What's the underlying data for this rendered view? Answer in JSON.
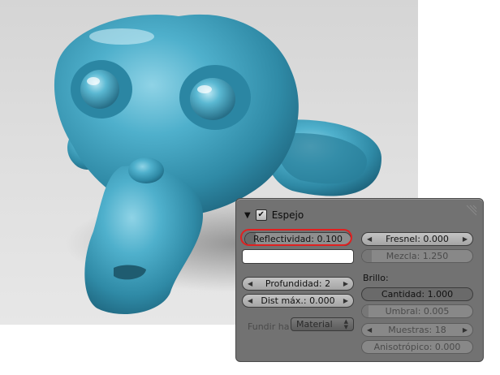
{
  "panel": {
    "title": "Espejo",
    "enabled": true,
    "reflectivity": {
      "label": "Reflectividad",
      "value": "0.100",
      "fill": 0.1
    },
    "color_hex": "#ffffff",
    "depth": {
      "label": "Profundidad",
      "value": "2"
    },
    "max_dist": {
      "label": "Dist máx.",
      "value": "0.000"
    },
    "fade_to": {
      "label": "Fundir ha",
      "value": "Material"
    },
    "fresnel": {
      "label": "Fresnel",
      "value": "0.000"
    },
    "blend": {
      "label": "Mezcla",
      "value": "1.250"
    },
    "gloss": {
      "heading": "Brillo:",
      "amount": {
        "label": "Cantidad",
        "value": "1.000"
      },
      "threshold": {
        "label": "Umbral",
        "value": "0.005"
      },
      "samples": {
        "label": "Muestras",
        "value": "18"
      },
      "anisotropic": {
        "label": "Anisotrópico",
        "value": "0.000"
      }
    }
  },
  "colors": {
    "monkey": "#3fa0c0",
    "highlight": "#e02020",
    "panel_bg": "#727272"
  }
}
